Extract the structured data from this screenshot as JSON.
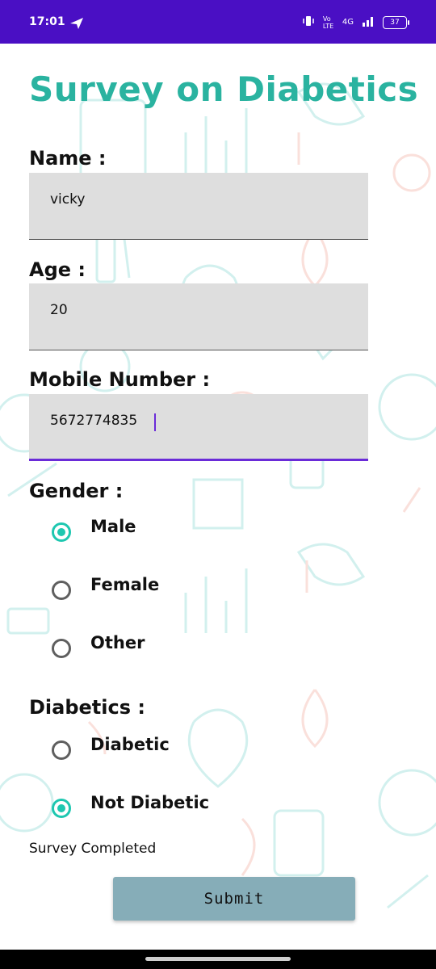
{
  "status_bar": {
    "time": "17:01",
    "network": "4G",
    "volte": "Vo LTE",
    "battery": "37"
  },
  "form": {
    "title": "Survey on Diabetics",
    "name": {
      "label": "Name :",
      "value": "vicky"
    },
    "age": {
      "label": "Age :",
      "value": "20"
    },
    "mobile": {
      "label": "Mobile Number :",
      "value": "5672774835"
    },
    "gender": {
      "label": "Gender :",
      "options": [
        {
          "label": "Male",
          "checked": true
        },
        {
          "label": "Female",
          "checked": false
        },
        {
          "label": "Other",
          "checked": false
        }
      ]
    },
    "diabetics": {
      "label": "Diabetics :",
      "options": [
        {
          "label": "Diabetic",
          "checked": false
        },
        {
          "label": "Not Diabetic",
          "checked": true
        }
      ]
    },
    "status": "Survey Completed",
    "submit_label": "Submit"
  },
  "colors": {
    "status_bar": "#4a0fc4",
    "title": "#2ab3a0",
    "radio_checked": "#1ec7b0",
    "submit_bg": "#86adb8",
    "focus_underline": "#6a2bd8"
  }
}
